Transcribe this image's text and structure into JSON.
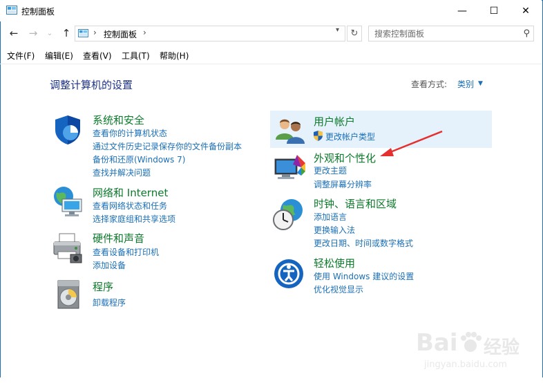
{
  "window": {
    "title": "控制面板",
    "minimize": "—",
    "maximize": "☐",
    "close": "✕"
  },
  "address": {
    "breadcrumb": "控制面板",
    "separator": "›"
  },
  "search": {
    "placeholder": "搜索控制面板"
  },
  "menu": [
    "文件(F)",
    "编辑(E)",
    "查看(V)",
    "工具(T)",
    "帮助(H)"
  ],
  "page": {
    "title": "调整计算机的设置",
    "view_label": "查看方式:",
    "view_value": "类别"
  },
  "left_categories": [
    {
      "title": "系统和安全",
      "icon": "shield-icon",
      "links": [
        "查看你的计算机状态",
        "通过文件历史记录保存你的文件备份副本",
        "备份和还原(Windows 7)",
        "查找并解决问题"
      ]
    },
    {
      "title": "网络和 Internet",
      "icon": "network-globe-icon",
      "links": [
        "查看网络状态和任务",
        "选择家庭组和共享选项"
      ]
    },
    {
      "title": "硬件和声音",
      "icon": "printer-icon",
      "links": [
        "查看设备和打印机",
        "添加设备"
      ]
    },
    {
      "title": "程序",
      "icon": "programs-disc-icon",
      "links": [
        "卸载程序"
      ]
    }
  ],
  "right_categories": [
    {
      "title": "用户帐户",
      "icon": "users-icon",
      "links": [
        "更改帐户类型"
      ]
    },
    {
      "title": "外观和个性化",
      "icon": "monitor-colors-icon",
      "links": [
        "更改主题",
        "调整屏幕分辨率"
      ]
    },
    {
      "title": "时钟、语言和区域",
      "icon": "clock-globe-icon",
      "links": [
        "添加语言",
        "更换输入法",
        "更改日期、时间或数字格式"
      ]
    },
    {
      "title": "轻松使用",
      "icon": "ease-of-access-icon",
      "links": [
        "使用 Windows 建议的设置",
        "优化视觉显示"
      ]
    }
  ],
  "watermark": {
    "brand": "Bai",
    "brand2": "经验",
    "url": "jingyan.baidu.com"
  },
  "colors": {
    "accent": "#1a6fb7",
    "category_title": "#0b7a2a",
    "page_title": "#1e3287",
    "highlight": "#e5f1fb",
    "annotation_arrow": "#e53030"
  }
}
